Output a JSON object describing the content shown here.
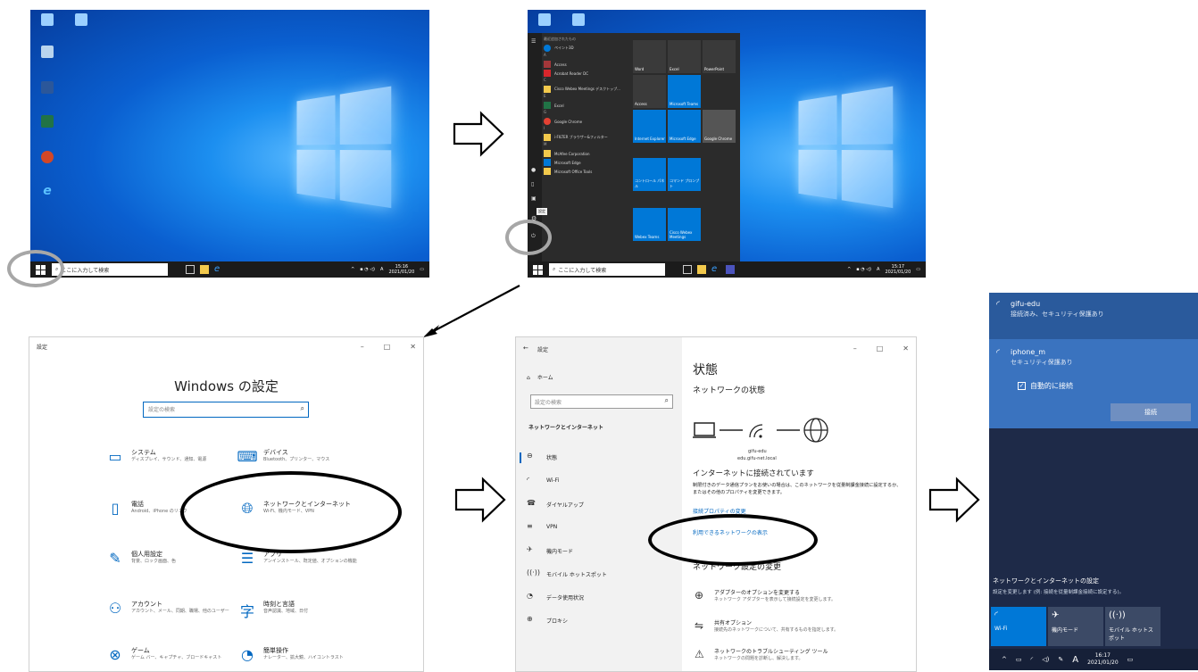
{
  "panel1": {
    "taskbar": {
      "search_placeholder": "ここに入力して検索",
      "time": "15:16",
      "date": "2021/01/20"
    }
  },
  "panel2": {
    "startmenu": {
      "recent_header": "最近追加されたもの",
      "apps": [
        "ペイント3D",
        "A",
        "Access",
        "Acrobat Reader DC",
        "C",
        "Cisco Webex Meetings デスクトップ...",
        "E",
        "Excel",
        "G",
        "Google Chrome",
        "I",
        "i-FILTER ブラウザー&フィルター",
        "M",
        "McAfee Corporation",
        "Microsoft Edge",
        "Microsoft Office Tools"
      ],
      "tiles": [
        "Word",
        "Excel",
        "PowerPoint",
        "Access",
        "Microsoft Teams",
        "Internet Explorer",
        "Microsoft Edge",
        "Google Chrome",
        "コントロール パネル",
        "コマンド プロンプト",
        "Webex Teams",
        "Cisco Webex Meetings"
      ],
      "settings_tooltip": "設定"
    },
    "taskbar": {
      "search_placeholder": "ここに入力して検索",
      "time": "15:17",
      "date": "2021/01/20"
    }
  },
  "settings_home": {
    "window_title": "設定",
    "heading": "Windows の設定",
    "search_placeholder": "設定の検索",
    "categories": [
      {
        "title": "システム",
        "sub": "ディスプレイ、サウンド、通知、電源"
      },
      {
        "title": "デバイス",
        "sub": "Bluetooth、プリンター、マウス"
      },
      {
        "title": "電話",
        "sub": "Android、iPhone のリンク"
      },
      {
        "title": "ネットワークとインターネット",
        "sub": "Wi-Fi、機内モード、VPN"
      },
      {
        "title": "個人用設定",
        "sub": "背景、ロック画面、色"
      },
      {
        "title": "アプリ",
        "sub": "アンインストール、既定値、オプションの機能"
      },
      {
        "title": "アカウント",
        "sub": "アカウント、メール、同期、職場、他のユーザー"
      },
      {
        "title": "時刻と言語",
        "sub": "音声認識、地域、日付"
      },
      {
        "title": "ゲーム",
        "sub": "ゲーム バー、キャプチャ、ブロードキャスト"
      },
      {
        "title": "簡単操作",
        "sub": "ナレーター、拡大鏡、ハイコントラスト"
      }
    ]
  },
  "network_status": {
    "window_title": "設定",
    "home": "ホーム",
    "search_placeholder": "設定の検索",
    "section": "ネットワークとインターネット",
    "nav": [
      "状態",
      "Wi-Fi",
      "ダイヤルアップ",
      "VPN",
      "機内モード",
      "モバイル ホットスポット",
      "データ使用状況",
      "プロキシ"
    ],
    "heading": "状態",
    "subheading": "ネットワークの状態",
    "network_name": "gifu-edu",
    "network_domain": "edu.gifu-net.local",
    "connected": "インターネットに接続されています",
    "desc": "制限付きのデータ通信プランをお使いの場合は、このネットワークを従量制課金接続に設定するか、またはその他のプロパティを変更できます。",
    "link_props": "接続プロパティの変更",
    "link_available": "利用できるネットワークの表示",
    "change_heading": "ネットワーク設定の変更",
    "options": [
      {
        "title": "アダプターのオプションを変更する",
        "sub": "ネットワーク アダプターを表示して接続設定を変更します。"
      },
      {
        "title": "共有オプション",
        "sub": "接続先のネットワークについて、共有するものを指定します。"
      },
      {
        "title": "ネットワークのトラブルシューティング ツール",
        "sub": "ネットワークの問題を診断し、解決します。"
      }
    ]
  },
  "wifi_flyout": {
    "network1": {
      "name": "gifu-edu",
      "status": "接続済み、セキュリティ保護あり"
    },
    "network2": {
      "name": "iphone_m",
      "status": "セキュリティ保護あり"
    },
    "auto_connect": "自動的に接続",
    "connect_button": "接続",
    "settings_title": "ネットワークとインターネットの設定",
    "settings_sub": "設定を変更します (例: 接続を従量制課金接続に設定する)。",
    "tiles": [
      "Wi-Fi",
      "機内モード",
      "モバイル ホットスポット"
    ],
    "time": "16:17",
    "date": "2021/01/20",
    "tray_a": "A"
  }
}
